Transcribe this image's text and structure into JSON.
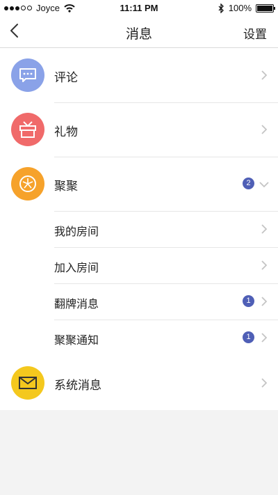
{
  "status_bar": {
    "carrier": "Joyce",
    "time": "11:11 PM",
    "battery": "100%"
  },
  "nav": {
    "title": "消息",
    "right": "设置"
  },
  "items": [
    {
      "label": "评论",
      "icon": "comment-icon",
      "color": "#8aa2e8"
    },
    {
      "label": "礼物",
      "icon": "gift-icon",
      "color": "#f06a6a"
    },
    {
      "label": "聚聚",
      "icon": "gathering-icon",
      "color": "#f6a22b",
      "badge": "2"
    },
    {
      "label": "系统消息",
      "icon": "envelope-icon",
      "color": "#f4c81e"
    }
  ],
  "subitems": [
    {
      "label": "我的房间"
    },
    {
      "label": "加入房间"
    },
    {
      "label": "翻牌消息",
      "badge": "1"
    },
    {
      "label": "聚聚通知",
      "badge": "1"
    }
  ],
  "colors": {
    "badge": "#4f5fb6",
    "background": "#f3f3f3"
  }
}
